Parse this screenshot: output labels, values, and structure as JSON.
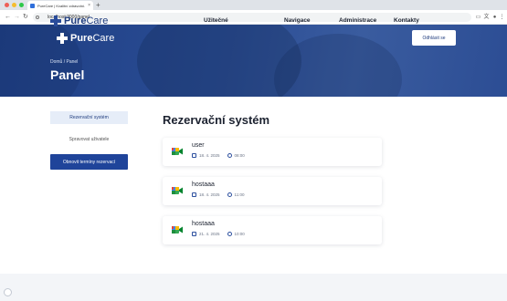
{
  "browser": {
    "tab_title": "PureCare | Kvalitní zdravotní...",
    "tab_close": "×",
    "new_tab": "+",
    "url": "localhost:3000/panel",
    "back": "←",
    "forward": "→",
    "reload": "↻"
  },
  "header": {
    "logo_bold": "Pure",
    "logo_light": "Care",
    "logout_label": "Odhlásit se",
    "breadcrumb": "Domů / Panel",
    "page_title": "Panel"
  },
  "sidebar": {
    "items": [
      {
        "label": "Rezervační systém",
        "active": true
      },
      {
        "label": "Spravovat uživatele",
        "active": false
      }
    ],
    "refresh_label": "Obnovit termíny rezervací"
  },
  "main": {
    "title": "Rezervační systém",
    "reservations": [
      {
        "name": "user",
        "date": "18. 4. 2025",
        "time": "08:00"
      },
      {
        "name": "hostaaa",
        "date": "18. 4. 2025",
        "time": "11:00"
      },
      {
        "name": "hostaaa",
        "date": "21. 4. 2025",
        "time": "10:00"
      }
    ]
  },
  "footer": {
    "logo_bold": "Pure",
    "logo_light": "Care",
    "headings": [
      "Užitečné",
      "Navigace",
      "Administrace",
      "Kontakty"
    ]
  },
  "colors": {
    "brand_blue": "#1f449a",
    "hero": "#2b4d95"
  }
}
